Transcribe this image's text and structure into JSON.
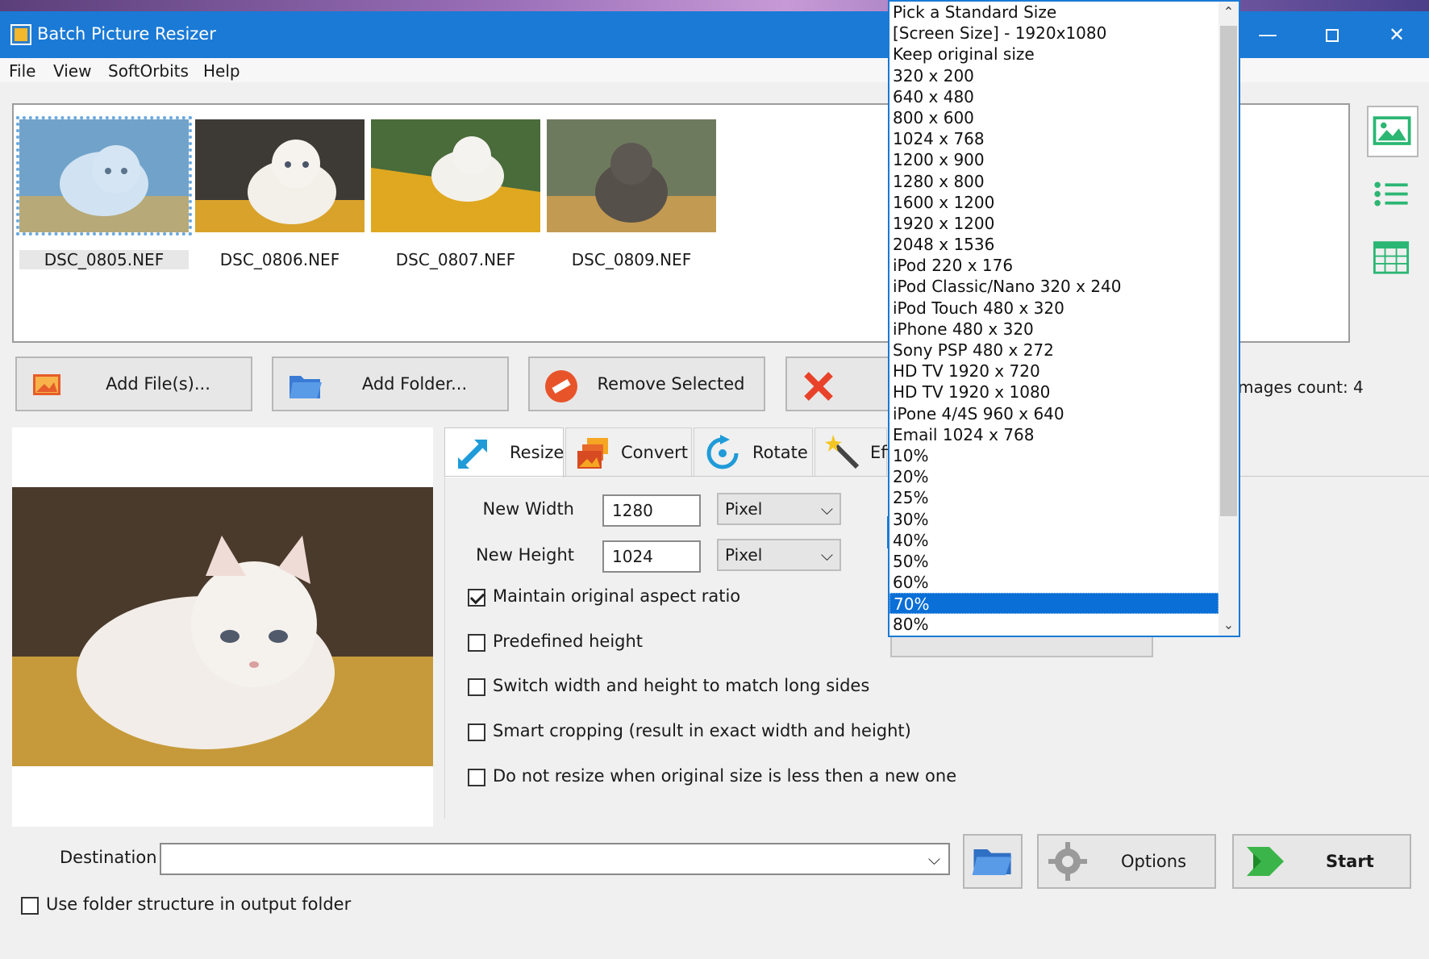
{
  "window": {
    "title": "Batch Picture Resizer",
    "minimize": "—",
    "close": "✕"
  },
  "menu": [
    "File",
    "View",
    "SoftOrbits",
    "Help"
  ],
  "files": [
    {
      "name": "DSC_0805.NEF",
      "selected": true
    },
    {
      "name": "DSC_0806.NEF",
      "selected": false
    },
    {
      "name": "DSC_0807.NEF",
      "selected": false
    },
    {
      "name": "DSC_0809.NEF",
      "selected": false
    }
  ],
  "buttons": {
    "add_files": "Add File(s)...",
    "add_folder": "Add Folder...",
    "remove_selected": "Remove Selected"
  },
  "images_count": "mages count: 4",
  "tabs": [
    "Resize",
    "Convert",
    "Rotate",
    "Eff"
  ],
  "resize": {
    "new_width_label": "New Width",
    "new_width_value": "1280",
    "new_height_label": "New Height",
    "new_height_value": "1024",
    "width_unit": "Pixel",
    "height_unit": "Pixel",
    "options": [
      {
        "label": "Maintain original aspect ratio",
        "checked": true
      },
      {
        "label": "Predefined height",
        "checked": false
      },
      {
        "label": "Switch width and height to match long sides",
        "checked": false
      },
      {
        "label": "Smart cropping (result in exact width and height)",
        "checked": false
      },
      {
        "label": "Do not resize when original size is less then a new one",
        "checked": false
      }
    ]
  },
  "standard_sizes": {
    "items": [
      "Pick a Standard Size",
      "[Screen Size] - 1920x1080",
      "Keep original size",
      "320 x 200",
      "640 x 480",
      "800 x 600",
      "1024 x 768",
      "1200 x 900",
      "1280 x 800",
      "1600 x 1200",
      "1920 x 1200",
      "2048 x 1536",
      "iPod 220 x 176",
      "iPod Classic/Nano 320 x 240",
      "iPod Touch 480 x 320",
      "iPhone 480 x 320",
      "Sony PSP 480 x 272",
      "HD TV 1920 x 720",
      "HD TV 1920 x 1080",
      "iPone 4/4S 960 x 640",
      "Email 1024 x 768",
      "10%",
      "20%",
      "25%",
      "30%",
      "40%",
      "50%",
      "60%",
      "70%",
      "80%"
    ],
    "selected": "70%"
  },
  "bottom": {
    "destination_label": "Destination",
    "destination_value": "",
    "options_label": "Options",
    "start_label": "Start",
    "folder_structure_label": "Use folder structure in output folder",
    "folder_structure_checked": false
  },
  "colors": {
    "accent": "#1a7ad6",
    "selected_row": "#0a6fd6"
  }
}
